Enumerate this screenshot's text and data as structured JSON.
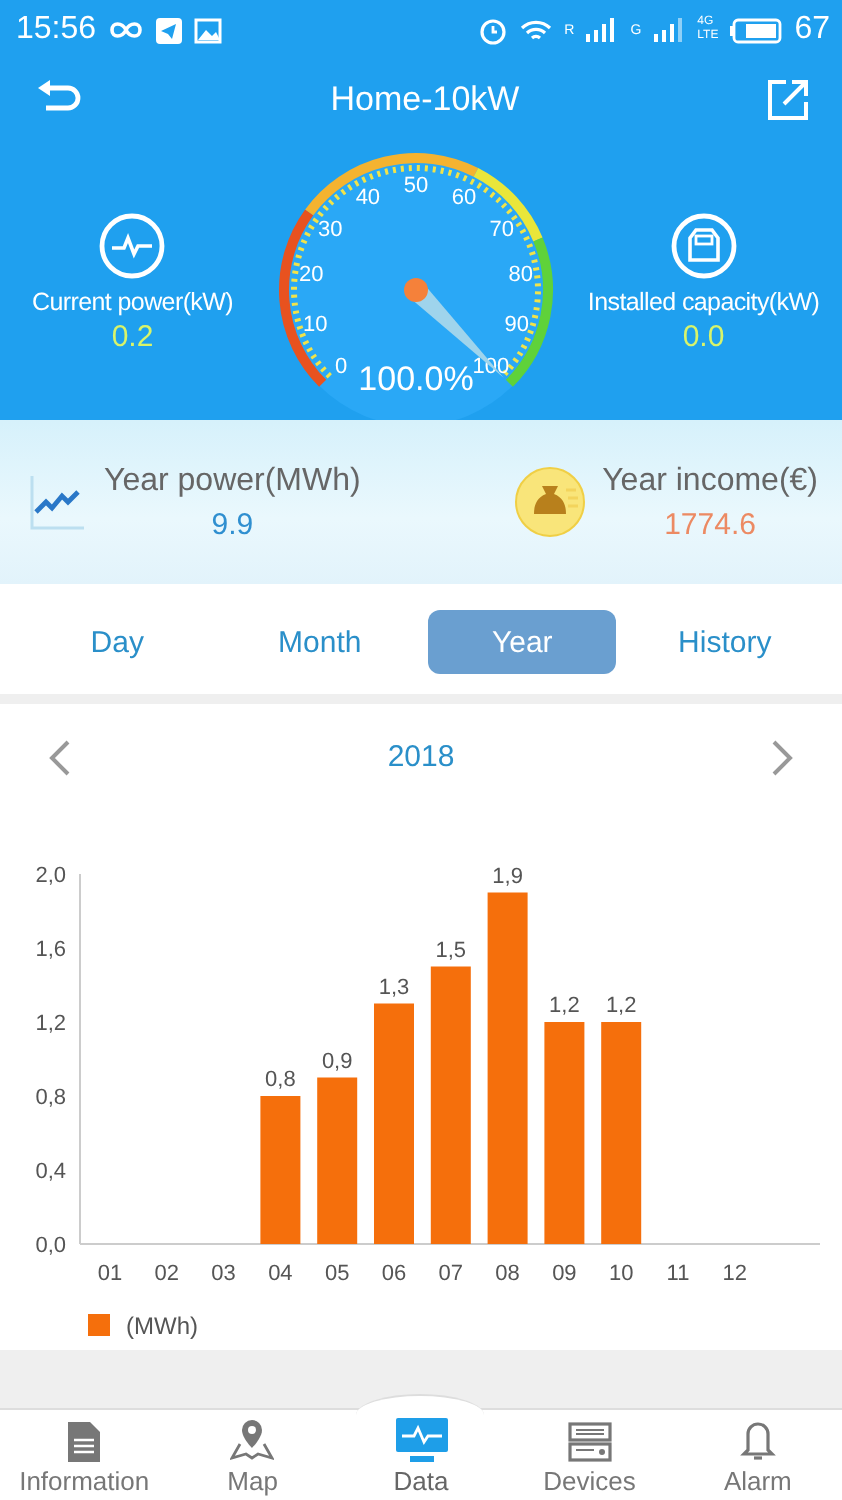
{
  "status_bar": {
    "time": "15:56",
    "network_labels": [
      "R",
      "G"
    ],
    "lte": [
      "4G",
      "LTE"
    ],
    "battery": "67"
  },
  "header": {
    "title": "Home-10kW"
  },
  "current_power": {
    "label": "Current power(kW)",
    "value": "0.2"
  },
  "gauge": {
    "scale": [
      "0",
      "10",
      "20",
      "30",
      "40",
      "50",
      "60",
      "70",
      "80",
      "90",
      "100"
    ],
    "reading": "100.0%"
  },
  "installed_capacity": {
    "label": "Installed capacity(kW)",
    "value": "0.0"
  },
  "summary": [
    {
      "kind": "power",
      "label": "Year power(MWh)",
      "value": "9.9"
    },
    {
      "kind": "income",
      "label": "Year income(€)",
      "value": "1774.6"
    }
  ],
  "tabs": [
    {
      "label": "Day",
      "selected": false
    },
    {
      "label": "Month",
      "selected": false
    },
    {
      "label": "Year",
      "selected": true
    },
    {
      "label": "History",
      "selected": false
    }
  ],
  "period": {
    "label": "2018"
  },
  "chart_data": {
    "type": "bar",
    "categories": [
      "01",
      "02",
      "03",
      "04",
      "05",
      "06",
      "07",
      "08",
      "09",
      "10",
      "11",
      "12"
    ],
    "series": [
      {
        "name": "(MWh)",
        "color": "#f56f0c",
        "values": [
          null,
          null,
          null,
          0.8,
          0.9,
          1.3,
          1.5,
          1.9,
          1.2,
          1.2,
          null,
          null
        ]
      }
    ],
    "ylim": [
      0,
      2.0
    ],
    "yticks": [
      {
        "value": 0,
        "label": "0,0"
      },
      {
        "value": 0.4,
        "label": "0,4"
      },
      {
        "value": 0.8,
        "label": "0,8"
      },
      {
        "value": 1.2,
        "label": "1,2"
      },
      {
        "value": 1.6,
        "label": "1,6"
      },
      {
        "value": 2.0,
        "label": "2,0"
      }
    ],
    "value_labels": [
      null,
      null,
      null,
      "0,8",
      "0,9",
      "1,3",
      "1,5",
      "1,9",
      "1,2",
      "1,2",
      null,
      null
    ]
  },
  "nav": [
    {
      "label": "Information",
      "selected": false
    },
    {
      "label": "Map",
      "selected": false
    },
    {
      "label": "Data",
      "selected": true
    },
    {
      "label": "Devices",
      "selected": false
    },
    {
      "label": "Alarm",
      "selected": false
    }
  ]
}
